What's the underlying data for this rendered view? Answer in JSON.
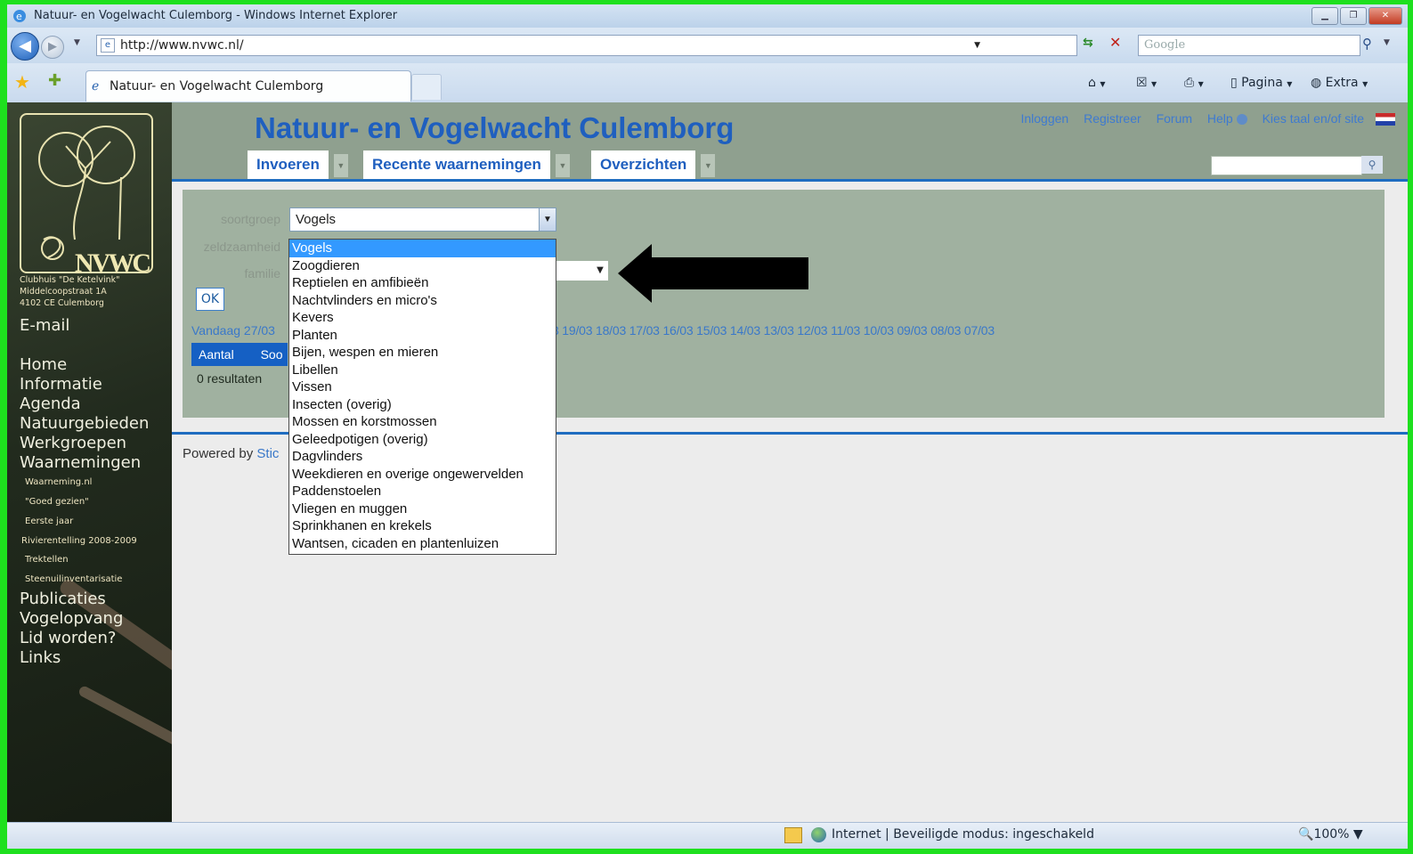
{
  "browser": {
    "window_title": "Natuur- en Vogelwacht Culemborg - Windows Internet Explorer",
    "url": "http://www.nvwc.nl/",
    "search_placeholder": "Google",
    "tab_title": "Natuur- en Vogelwacht Culemborg",
    "commands": {
      "page": "Pagina",
      "extra": "Extra"
    },
    "status": "Internet | Beveiligde modus: ingeschakeld",
    "zoom": "100%"
  },
  "sidebar": {
    "logo_text": "NVWC",
    "address": [
      "Clubhuis \"De Ketelvink\"",
      "Middelcoopstraat 1A",
      "4102 CE Culemborg"
    ],
    "email": "E-mail",
    "menu": [
      "Home",
      "Informatie",
      "Agenda",
      "Natuurgebieden",
      "Werkgroepen",
      "Waarnemingen"
    ],
    "submenu": [
      "Waarneming.nl",
      "\"Goed gezien\"",
      "Eerste jaar",
      "Rivierentelling 2008-2009",
      "Trektellen",
      "Steenuilinventarisatie"
    ],
    "menu2": [
      "Publicaties",
      "Vogelopvang",
      "Lid worden?",
      "Links"
    ]
  },
  "header": {
    "title": "Natuur- en Vogelwacht Culemborg",
    "links": [
      "Inloggen",
      "Registreer",
      "Forum",
      "Help",
      "Kies taal en/of site"
    ],
    "tabs": [
      "Invoeren",
      "Recente waarnemingen",
      "Overzichten"
    ]
  },
  "form": {
    "label_group": "soortgroep",
    "label_rarity": "zeldzaamheid",
    "label_family": "familie",
    "selected_group": "Vogels",
    "ok": "OK",
    "today": "Vandaag 27/03",
    "dates": "3 19/03 18/03 17/03 16/03 15/03 14/03 13/03 12/03 11/03 10/03 09/03 08/03 07/03",
    "col_count": "Aantal",
    "col_species": "Soo",
    "results": "0 resultaten"
  },
  "dropdown_options": [
    "Vogels",
    "Zoogdieren",
    "Reptielen en amfibieën",
    "Nachtvlinders en micro's",
    "Kevers",
    "Planten",
    "Bijen, wespen en mieren",
    "Libellen",
    "Vissen",
    "Insecten (overig)",
    "Mossen en korstmossen",
    "Geleedpotigen (overig)",
    "Dagvlinders",
    "Weekdieren en overige ongewervelden",
    "Paddenstoelen",
    "Vliegen en muggen",
    "Sprinkhanen en krekels",
    "Wantsen, cicaden en plantenluizen"
  ],
  "footer": {
    "powered_by": "Powered by",
    "powered_link": "Stic"
  }
}
